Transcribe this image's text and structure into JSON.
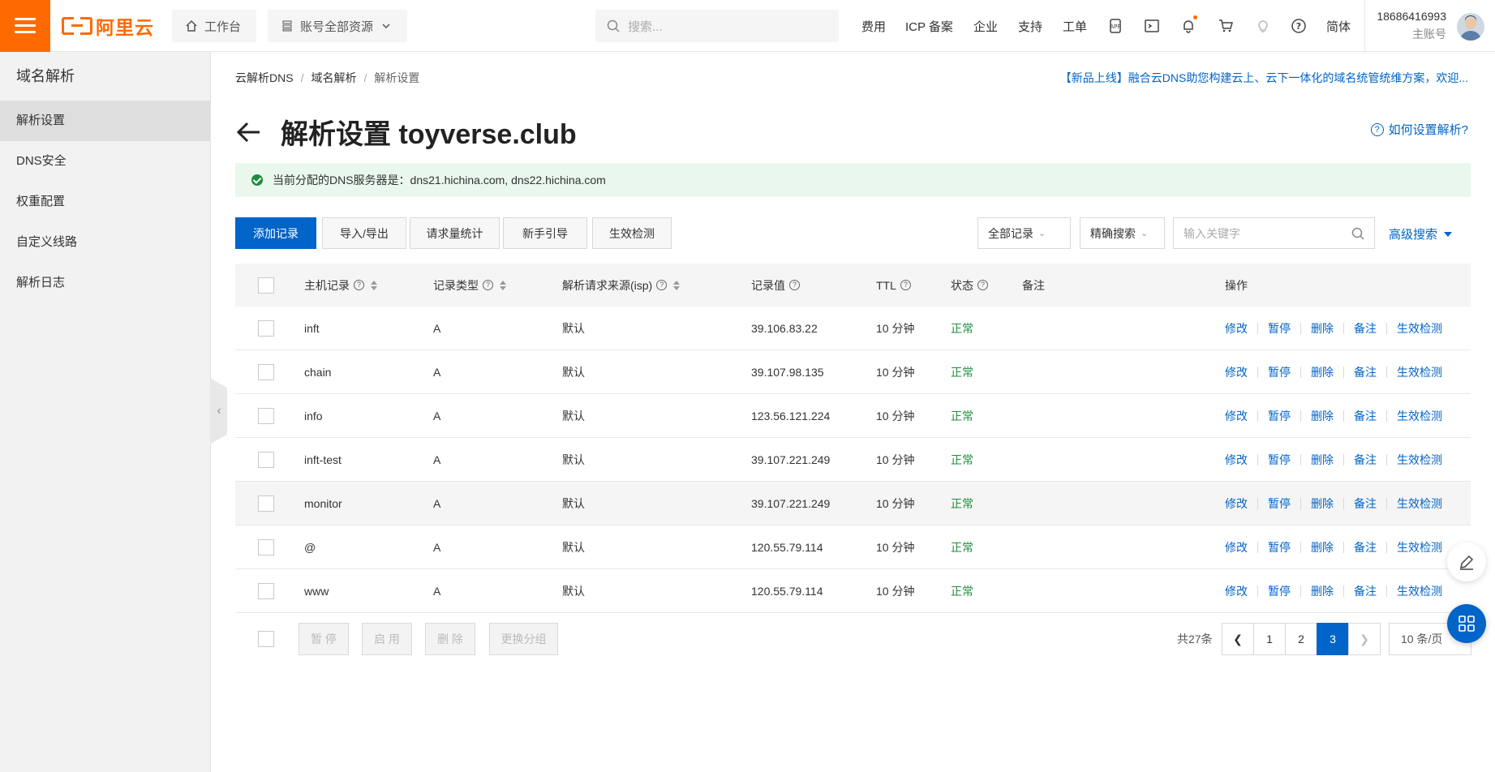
{
  "topbar": {
    "brand": "阿里云",
    "workbench": "工作台",
    "resource_scope": "账号全部资源",
    "search_placeholder": "搜索...",
    "links": [
      "费用",
      "ICP 备案",
      "企业",
      "支持",
      "工单"
    ],
    "language": "简体",
    "user_phone": "18686416993",
    "user_role": "主账号",
    "accent_color": "#ff6a00"
  },
  "sidebar": {
    "title": "域名解析",
    "items": [
      {
        "label": "解析设置",
        "active": true
      },
      {
        "label": "DNS安全",
        "active": false
      },
      {
        "label": "权重配置",
        "active": false
      },
      {
        "label": "自定义线路",
        "active": false
      },
      {
        "label": "解析日志",
        "active": false
      }
    ]
  },
  "breadcrumb": [
    "云解析DNS",
    "域名解析",
    "解析设置"
  ],
  "promo": "【新品上线】融合云DNS助您构建云上、云下一体化的域名统管统维方案，欢迎...",
  "page_title": "解析设置 toyverse.club",
  "help_link": "如何设置解析?",
  "dns_notice": "当前分配的DNS服务器是：dns21.hichina.com, dns22.hichina.com",
  "toolbar": {
    "add_record": "添加记录",
    "import_export": "导入/导出",
    "request_stats": "请求量统计",
    "guide": "新手引导",
    "check": "生效检测",
    "all_records": "全部记录",
    "exact_search": "精确搜索",
    "keyword_placeholder": "输入关键字",
    "advanced_search": "高级搜索"
  },
  "table": {
    "columns": [
      "主机记录",
      "记录类型",
      "解析请求来源(isp)",
      "记录值",
      "TTL",
      "状态",
      "备注",
      "操作"
    ],
    "actions": [
      "修改",
      "暂停",
      "删除",
      "备注",
      "生效检测"
    ],
    "rows": [
      {
        "host": "inft",
        "type": "A",
        "isp": "默认",
        "value": "39.106.83.22",
        "ttl": "10 分钟",
        "status": "正常",
        "note": ""
      },
      {
        "host": "chain",
        "type": "A",
        "isp": "默认",
        "value": "39.107.98.135",
        "ttl": "10 分钟",
        "status": "正常",
        "note": ""
      },
      {
        "host": "info",
        "type": "A",
        "isp": "默认",
        "value": "123.56.121.224",
        "ttl": "10 分钟",
        "status": "正常",
        "note": ""
      },
      {
        "host": "inft-test",
        "type": "A",
        "isp": "默认",
        "value": "39.107.221.249",
        "ttl": "10 分钟",
        "status": "正常",
        "note": ""
      },
      {
        "host": "monitor",
        "type": "A",
        "isp": "默认",
        "value": "39.107.221.249",
        "ttl": "10 分钟",
        "status": "正常",
        "note": ""
      },
      {
        "host": "@",
        "type": "A",
        "isp": "默认",
        "value": "120.55.79.114",
        "ttl": "10 分钟",
        "status": "正常",
        "note": ""
      },
      {
        "host": "www",
        "type": "A",
        "isp": "默认",
        "value": "120.55.79.114",
        "ttl": "10 分钟",
        "status": "正常",
        "note": ""
      }
    ]
  },
  "bulk": {
    "pause": "暂 停",
    "enable": "启 用",
    "delete": "删 除",
    "change_group": "更换分组"
  },
  "pagination": {
    "total": "共27条",
    "pages": [
      "1",
      "2",
      "3"
    ],
    "current": "3",
    "page_size": "10 条/页"
  }
}
